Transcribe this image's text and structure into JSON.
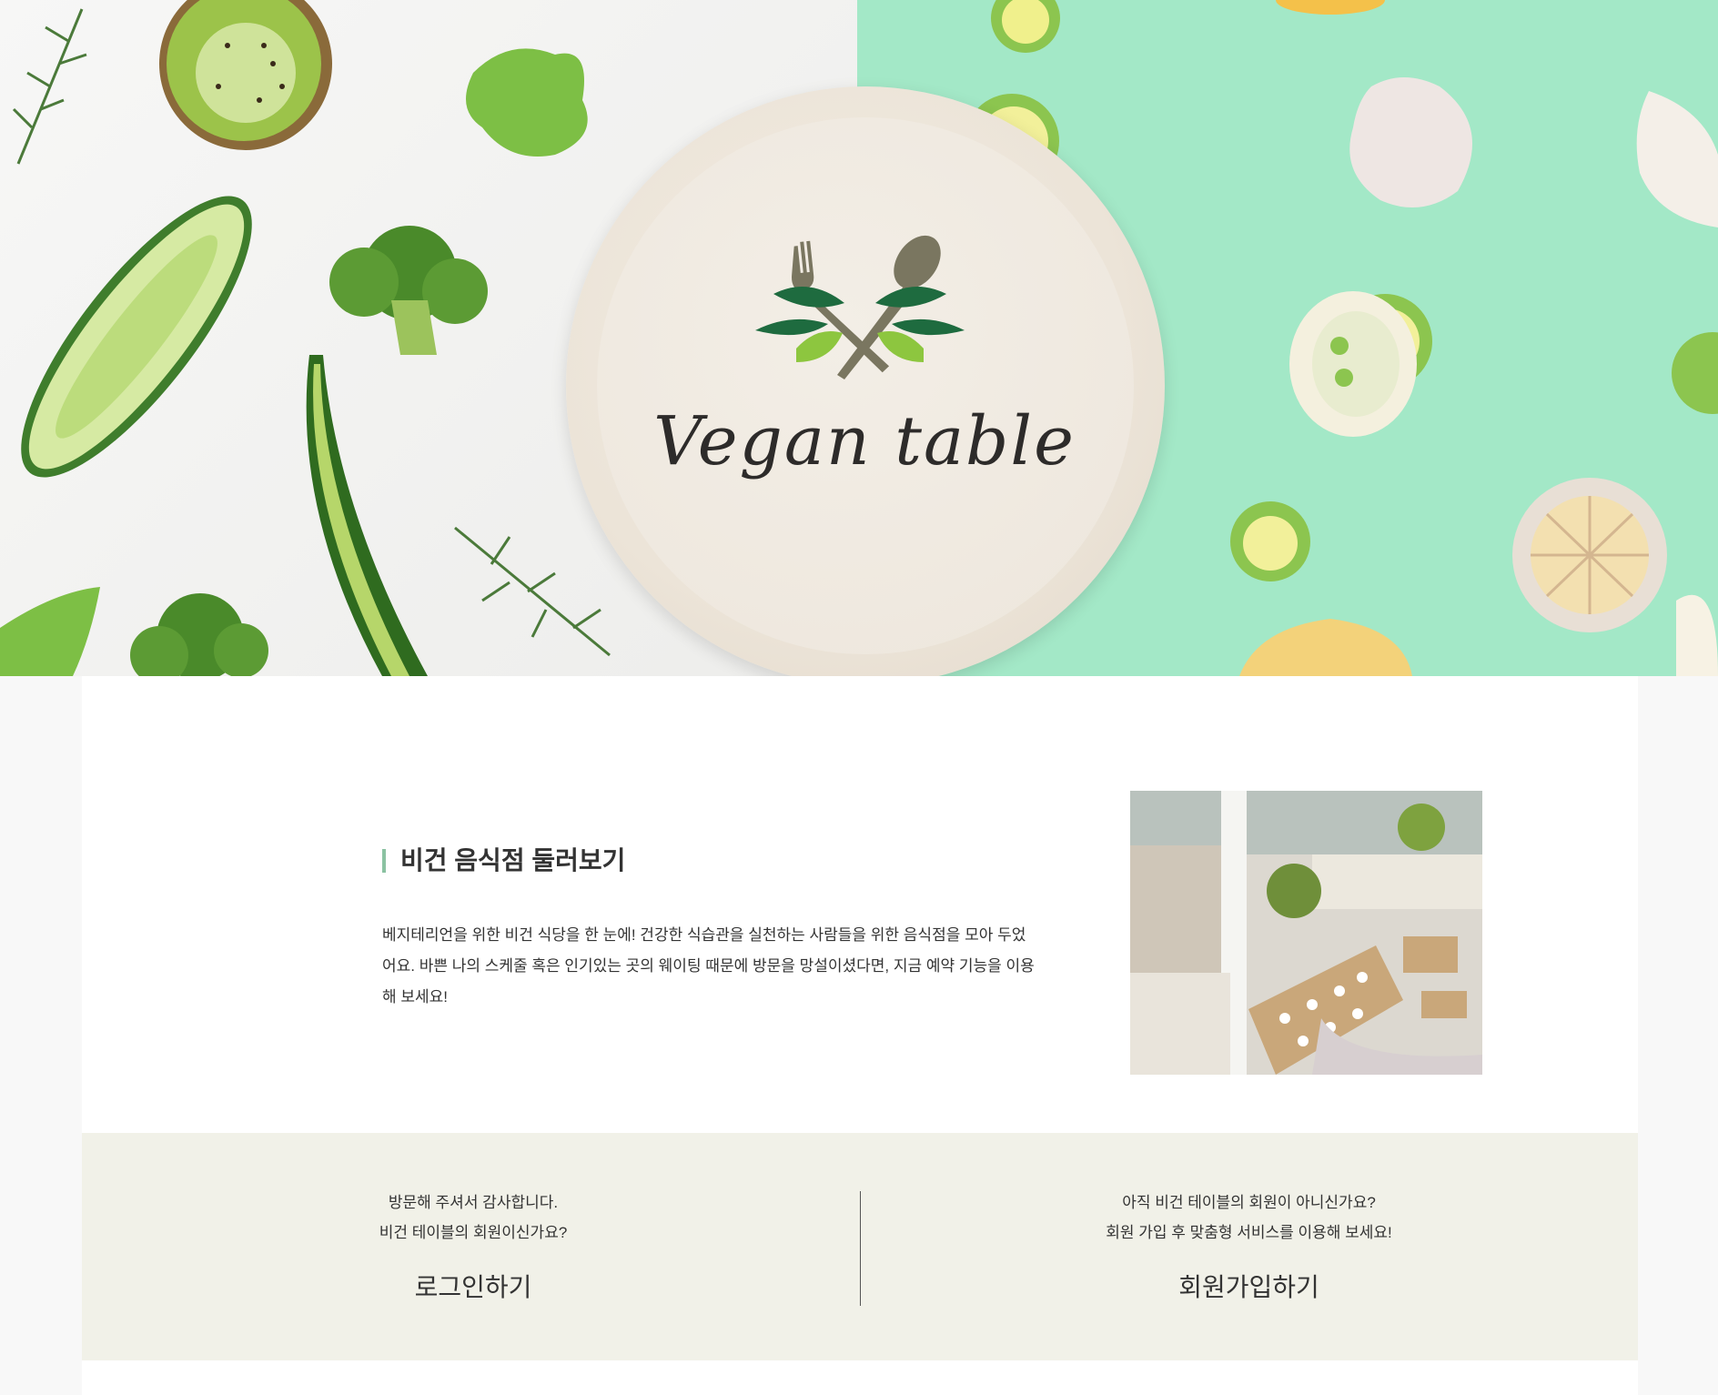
{
  "hero": {
    "brand": "Vegan table",
    "colors": {
      "left_bg": "#f3f3f1",
      "right_bg": "#a3e8c7",
      "plate": "#ede6dc",
      "leaf_dark": "#1e6b3f",
      "leaf_light": "#8dc63f",
      "utensil": "#7a7660"
    }
  },
  "intro": {
    "title": "비건 음식점 둘러보기",
    "body": "베지테리언을 위한 비건 식당을 한 눈에! 건강한 식습관을 실천하는 사람들을 위한 음식점을 모아 두었어요. 바쁜 나의 스케줄 혹은 인기있는 곳의 웨이팅 때문에 방문을 망설이셨다면, 지금 예약 기능을 이용해 보세요!",
    "accent": "#8bc2a2"
  },
  "member": {
    "login": {
      "line1": "방문해 주셔서 감사합니다.",
      "line2": "비건 테이블의 회원이신가요?",
      "action": "로그인하기"
    },
    "signup": {
      "line1": "아직 비건 테이블의 회원이 아니신가요?",
      "line2": "회원 가입 후 맞춤형 서비스를 이용해 보세요!",
      "action": "회원가입하기"
    },
    "bg": "#f1f1e8"
  },
  "icons": [
    "fork-icon",
    "spoon-icon",
    "leaf-icon"
  ]
}
